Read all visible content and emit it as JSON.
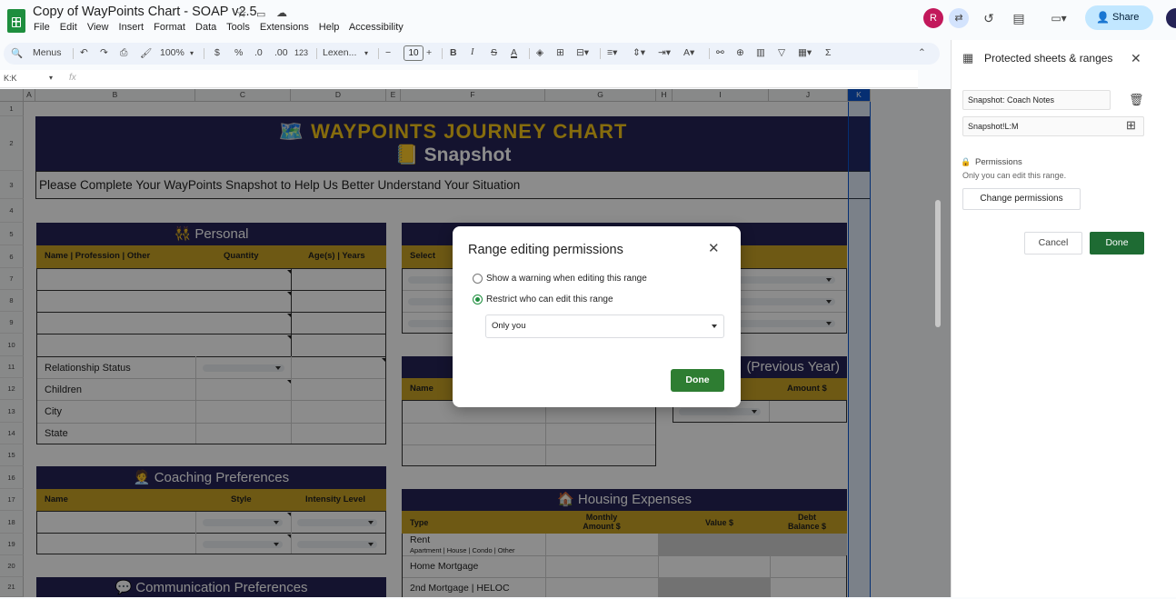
{
  "app": {
    "doc_title": "Copy of WayPoints Chart - SOAP v2.5",
    "menus": [
      "File",
      "Edit",
      "View",
      "Insert",
      "Format",
      "Data",
      "Tools",
      "Extensions",
      "Help",
      "Accessibility"
    ],
    "avatar_letter": "R",
    "share_label": "Share"
  },
  "toolbar": {
    "menus_label": "Menus",
    "zoom": "100%",
    "currency": "$",
    "percent": "%",
    "dec_decrease": ".0",
    "dec_increase": ".00",
    "number_format": "123",
    "font": "Lexen...",
    "font_size": "10",
    "bold": "B",
    "italic": "I",
    "strike": "S",
    "text_color": "A",
    "sum": "Σ"
  },
  "formula_bar": {
    "name_box": "K:K",
    "fx": "fx"
  },
  "columns": [
    "A",
    "B",
    "C",
    "D",
    "E",
    "F",
    "G",
    "H",
    "I",
    "J",
    "K"
  ],
  "rows": [
    "1",
    "2",
    "3",
    "4",
    "5",
    "6",
    "7",
    "8",
    "9",
    "10",
    "11",
    "12",
    "13",
    "14",
    "15",
    "16",
    "17",
    "18",
    "19",
    "20",
    "21"
  ],
  "sheet": {
    "title_line1": "🗺️ WAYPOINTS JOURNEY CHART",
    "title_line2": "📒 Snapshot",
    "subtitle": "Please Complete Your WayPoints Snapshot to Help Us Better Understand Your Situation",
    "personal": {
      "header": "👯 Personal",
      "cols": [
        "Name | Profession | Other",
        "Quantity",
        "Age(s) | Years"
      ],
      "rows": [
        "Relationship Status",
        "Children",
        "City",
        "State"
      ]
    },
    "coaching": {
      "header": "🧑‍💼 Coaching Preferences",
      "cols": [
        "Name",
        "Style",
        "Intensity Level"
      ]
    },
    "communication": {
      "header": "💬 Communication Preferences"
    },
    "select_box": {
      "col": "Select"
    },
    "name_box": {
      "col": "Name"
    },
    "income": {
      "header_partial": "(Previous Year)",
      "col": "Amount $"
    },
    "housing": {
      "header": "🏠 Housing Expenses",
      "cols": [
        "Type",
        "Monthly\nAmount $",
        "Value $",
        "Debt\nBalance $"
      ],
      "rows": [
        {
          "label": "Rent",
          "sub": "Apartment | House | Condo | Other"
        },
        {
          "label": "Home Mortgage",
          "sub": ""
        },
        {
          "label": "2nd Mortgage | HELOC",
          "sub": ""
        }
      ]
    }
  },
  "dialog": {
    "title": "Range editing permissions",
    "option1": "Show a warning when editing this range",
    "option2": "Restrict who can edit this range",
    "selected_option": 2,
    "select_value": "Only you",
    "done": "Done"
  },
  "panel": {
    "title": "Protected sheets & ranges",
    "description_field": "Snapshot: Coach Notes",
    "range_field": "Snapshot!L:M",
    "permissions_title": "Permissions",
    "permissions_sub": "Only you can edit this range.",
    "change_button": "Change permissions",
    "cancel": "Cancel",
    "done": "Done"
  },
  "colors": {
    "navy": "#252356",
    "gold": "#c8a326",
    "title_gold": "#f5c518",
    "done_green": "#2e7d32",
    "share_blue": "#c2e7ff"
  }
}
